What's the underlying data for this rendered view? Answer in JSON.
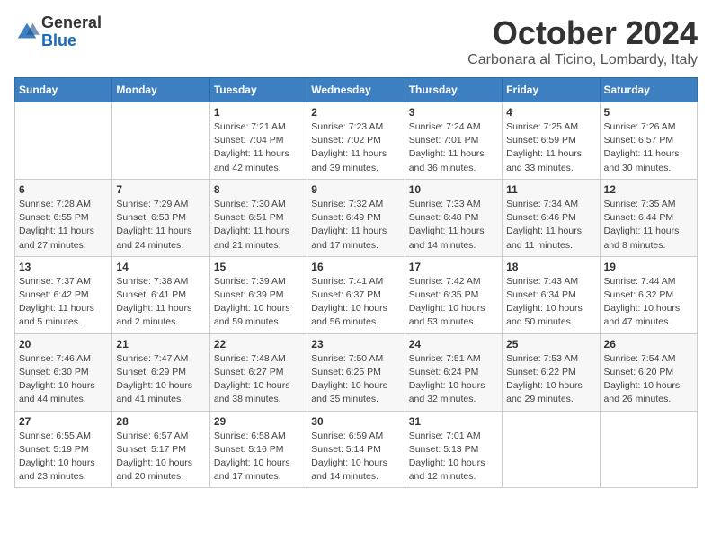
{
  "header": {
    "logo_line1": "General",
    "logo_line2": "Blue",
    "month": "October 2024",
    "location": "Carbonara al Ticino, Lombardy, Italy"
  },
  "weekdays": [
    "Sunday",
    "Monday",
    "Tuesday",
    "Wednesday",
    "Thursday",
    "Friday",
    "Saturday"
  ],
  "weeks": [
    [
      {
        "day": "",
        "info": ""
      },
      {
        "day": "",
        "info": ""
      },
      {
        "day": "1",
        "info": "Sunrise: 7:21 AM\nSunset: 7:04 PM\nDaylight: 11 hours and 42 minutes."
      },
      {
        "day": "2",
        "info": "Sunrise: 7:23 AM\nSunset: 7:02 PM\nDaylight: 11 hours and 39 minutes."
      },
      {
        "day": "3",
        "info": "Sunrise: 7:24 AM\nSunset: 7:01 PM\nDaylight: 11 hours and 36 minutes."
      },
      {
        "day": "4",
        "info": "Sunrise: 7:25 AM\nSunset: 6:59 PM\nDaylight: 11 hours and 33 minutes."
      },
      {
        "day": "5",
        "info": "Sunrise: 7:26 AM\nSunset: 6:57 PM\nDaylight: 11 hours and 30 minutes."
      }
    ],
    [
      {
        "day": "6",
        "info": "Sunrise: 7:28 AM\nSunset: 6:55 PM\nDaylight: 11 hours and 27 minutes."
      },
      {
        "day": "7",
        "info": "Sunrise: 7:29 AM\nSunset: 6:53 PM\nDaylight: 11 hours and 24 minutes."
      },
      {
        "day": "8",
        "info": "Sunrise: 7:30 AM\nSunset: 6:51 PM\nDaylight: 11 hours and 21 minutes."
      },
      {
        "day": "9",
        "info": "Sunrise: 7:32 AM\nSunset: 6:49 PM\nDaylight: 11 hours and 17 minutes."
      },
      {
        "day": "10",
        "info": "Sunrise: 7:33 AM\nSunset: 6:48 PM\nDaylight: 11 hours and 14 minutes."
      },
      {
        "day": "11",
        "info": "Sunrise: 7:34 AM\nSunset: 6:46 PM\nDaylight: 11 hours and 11 minutes."
      },
      {
        "day": "12",
        "info": "Sunrise: 7:35 AM\nSunset: 6:44 PM\nDaylight: 11 hours and 8 minutes."
      }
    ],
    [
      {
        "day": "13",
        "info": "Sunrise: 7:37 AM\nSunset: 6:42 PM\nDaylight: 11 hours and 5 minutes."
      },
      {
        "day": "14",
        "info": "Sunrise: 7:38 AM\nSunset: 6:41 PM\nDaylight: 11 hours and 2 minutes."
      },
      {
        "day": "15",
        "info": "Sunrise: 7:39 AM\nSunset: 6:39 PM\nDaylight: 10 hours and 59 minutes."
      },
      {
        "day": "16",
        "info": "Sunrise: 7:41 AM\nSunset: 6:37 PM\nDaylight: 10 hours and 56 minutes."
      },
      {
        "day": "17",
        "info": "Sunrise: 7:42 AM\nSunset: 6:35 PM\nDaylight: 10 hours and 53 minutes."
      },
      {
        "day": "18",
        "info": "Sunrise: 7:43 AM\nSunset: 6:34 PM\nDaylight: 10 hours and 50 minutes."
      },
      {
        "day": "19",
        "info": "Sunrise: 7:44 AM\nSunset: 6:32 PM\nDaylight: 10 hours and 47 minutes."
      }
    ],
    [
      {
        "day": "20",
        "info": "Sunrise: 7:46 AM\nSunset: 6:30 PM\nDaylight: 10 hours and 44 minutes."
      },
      {
        "day": "21",
        "info": "Sunrise: 7:47 AM\nSunset: 6:29 PM\nDaylight: 10 hours and 41 minutes."
      },
      {
        "day": "22",
        "info": "Sunrise: 7:48 AM\nSunset: 6:27 PM\nDaylight: 10 hours and 38 minutes."
      },
      {
        "day": "23",
        "info": "Sunrise: 7:50 AM\nSunset: 6:25 PM\nDaylight: 10 hours and 35 minutes."
      },
      {
        "day": "24",
        "info": "Sunrise: 7:51 AM\nSunset: 6:24 PM\nDaylight: 10 hours and 32 minutes."
      },
      {
        "day": "25",
        "info": "Sunrise: 7:53 AM\nSunset: 6:22 PM\nDaylight: 10 hours and 29 minutes."
      },
      {
        "day": "26",
        "info": "Sunrise: 7:54 AM\nSunset: 6:20 PM\nDaylight: 10 hours and 26 minutes."
      }
    ],
    [
      {
        "day": "27",
        "info": "Sunrise: 6:55 AM\nSunset: 5:19 PM\nDaylight: 10 hours and 23 minutes."
      },
      {
        "day": "28",
        "info": "Sunrise: 6:57 AM\nSunset: 5:17 PM\nDaylight: 10 hours and 20 minutes."
      },
      {
        "day": "29",
        "info": "Sunrise: 6:58 AM\nSunset: 5:16 PM\nDaylight: 10 hours and 17 minutes."
      },
      {
        "day": "30",
        "info": "Sunrise: 6:59 AM\nSunset: 5:14 PM\nDaylight: 10 hours and 14 minutes."
      },
      {
        "day": "31",
        "info": "Sunrise: 7:01 AM\nSunset: 5:13 PM\nDaylight: 10 hours and 12 minutes."
      },
      {
        "day": "",
        "info": ""
      },
      {
        "day": "",
        "info": ""
      }
    ]
  ]
}
